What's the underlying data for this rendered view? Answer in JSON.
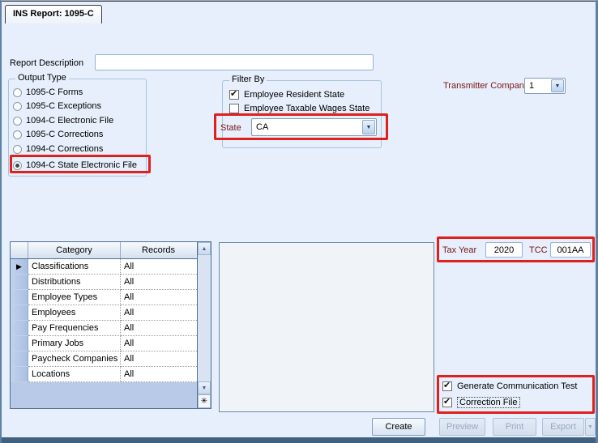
{
  "window": {
    "title": "INS Report: 1095-C"
  },
  "icons": {
    "checkmark": "✔",
    "dropdown_arrow": "▼",
    "scroll_up": "▲",
    "scroll_down": "▼",
    "new_row_star": "✳",
    "row_marker": "▶"
  },
  "report_description": {
    "label": "Report Description",
    "value": ""
  },
  "output_type": {
    "legend": "Output Type",
    "options": [
      {
        "label": "1095-C Forms",
        "selected": false
      },
      {
        "label": "1095-C Exceptions",
        "selected": false
      },
      {
        "label": "1094-C Electronic File",
        "selected": false
      },
      {
        "label": "1095-C Corrections",
        "selected": false
      },
      {
        "label": "1094-C Corrections",
        "selected": false
      },
      {
        "label": "1094-C State Electronic File",
        "selected": true,
        "highlighted": true
      }
    ]
  },
  "filter_by": {
    "legend": "Filter By",
    "employee_resident_state": {
      "label": "Employee Resident State",
      "checked": true
    },
    "employee_taxable_wages_state": {
      "label": "Employee Taxable Wages State",
      "checked": false
    },
    "state": {
      "label": "State",
      "value": "CA",
      "highlighted": true
    }
  },
  "transmitter_company": {
    "label": "Transmitter Company",
    "value": "1"
  },
  "filters_table": {
    "columns": {
      "category": "Category",
      "records": "Records"
    },
    "rows": [
      {
        "category": "Classifications",
        "records": "All",
        "current": true
      },
      {
        "category": "Distributions",
        "records": "All",
        "current": false
      },
      {
        "category": "Employee Types",
        "records": "All",
        "current": false
      },
      {
        "category": "Employees",
        "records": "All",
        "current": false
      },
      {
        "category": "Pay Frequencies",
        "records": "All",
        "current": false
      },
      {
        "category": "Primary Jobs",
        "records": "All",
        "current": false
      },
      {
        "category": "Paycheck Companies",
        "records": "All",
        "current": false
      },
      {
        "category": "Locations",
        "records": "All",
        "current": false
      }
    ]
  },
  "file_options": {
    "highlighted": true,
    "tax_year": {
      "label": "Tax Year",
      "value": "2020"
    },
    "tcc": {
      "label": "TCC",
      "value": "001AA"
    }
  },
  "generation_options": {
    "highlighted": true,
    "generate_communication_test": {
      "label": "Generate Communication Test",
      "checked": true
    },
    "correction_file": {
      "label": "Correction File",
      "checked": true,
      "focused": true
    }
  },
  "action_buttons": {
    "create": {
      "label": "Create",
      "enabled": true
    },
    "preview": {
      "label": "Preview",
      "enabled": false
    },
    "print": {
      "label": "Print",
      "enabled": false
    },
    "export": {
      "label": "Export",
      "enabled": false
    }
  },
  "colors": {
    "highlight_red": "#E0201C",
    "field_label_maroon": "#7B1416",
    "window_background": "#E6EFFB",
    "disabled_text": "#9AA9BD"
  }
}
